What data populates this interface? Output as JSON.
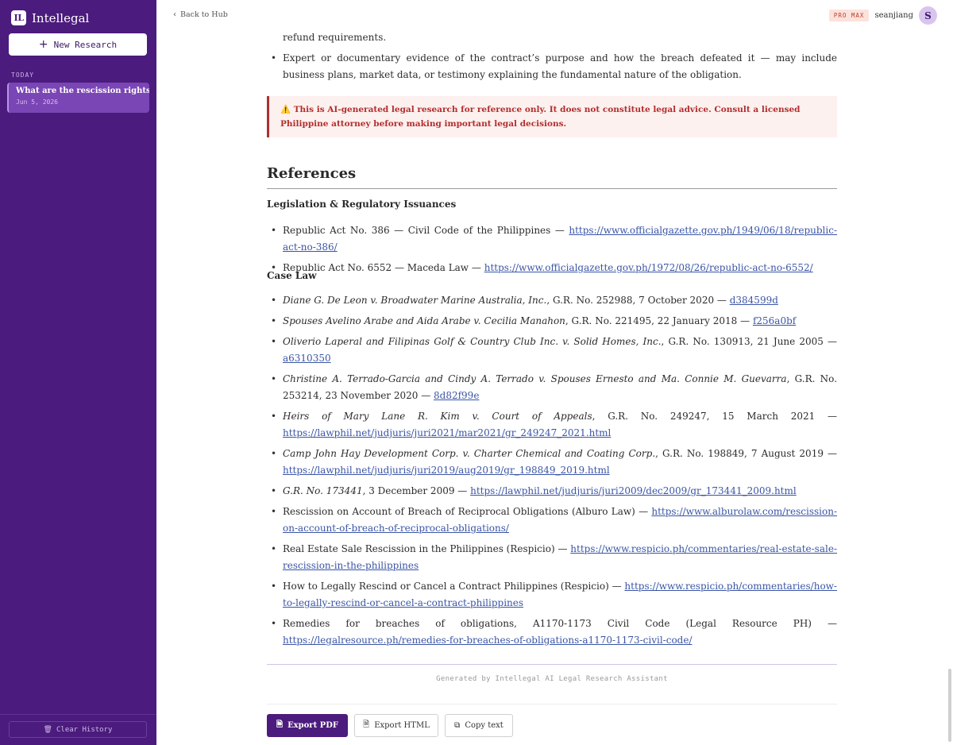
{
  "app": {
    "logo_text": "IL",
    "name": "Intellegal",
    "new_research": "New Research",
    "today_label": "TODAY",
    "history": [
      {
        "title": "What are the rescission rights ...",
        "date": "Jun 5, 2026"
      }
    ],
    "clear_history": "Clear History"
  },
  "topbar": {
    "back": "Back to Hub",
    "plan_badge": "PRO MAX",
    "username": "seanjiang",
    "avatar_initial": "S"
  },
  "content": {
    "intro_tail": "refund requirements.",
    "intro_bullet": "Expert or documentary evidence of the contract’s purpose and how the breach defeated it — may include business plans, market data, or testimony explaining the fundamental nature of the obligation.",
    "warning": "⚠️ This is AI-generated legal research for reference only. It does not constitute legal advice. Consult a licensed Philippine attorney before making important legal decisions.",
    "references_heading": "References",
    "legislation_heading": "Legislation & Regulatory Issuances",
    "legislation": [
      {
        "text": "Republic Act No. 386 — Civil Code of the Philippines — ",
        "link": "https://www.officialgazette.gov.ph/1949/06/18/republic-act-no-386/"
      },
      {
        "text": "Republic Act No. 6552 — Maceda Law — ",
        "link": "https://www.officialgazette.gov.ph/1972/08/26/republic-act-no-6552/"
      }
    ],
    "caselaw_heading": "Case Law",
    "cases": [
      {
        "case": "Diane G. De Leon v. Broadwater Marine Australia, Inc.",
        "citation": ", G.R. No. 252988, 7 October 2020 — ",
        "link": "d384599d"
      },
      {
        "case": "Spouses Avelino Arabe and Aida Arabe v. Cecilia Manahon",
        "citation": ", G.R. No. 221495, 22 January 2018 — ",
        "link": "f256a0bf"
      },
      {
        "case": "Oliverio Laperal and Filipinas Golf & Country Club Inc. v. Solid Homes, Inc.",
        "citation": ", G.R. No. 130913, 21 June 2005 — ",
        "link": "a6310350"
      },
      {
        "case": "Christine A. Terrado-Garcia and Cindy A. Terrado v. Spouses Ernesto and Ma. Connie M. Guevarra",
        "citation": ", G.R. No. 253214, 23 November 2020 — ",
        "link": "8d82f99e"
      },
      {
        "case": "Heirs of Mary Lane R. Kim v. Court of Appeals",
        "citation": ", G.R. No. 249247, 15 March 2021 — ",
        "link": "https://lawphil.net/judjuris/juri2021/mar2021/gr_249247_2021.html"
      },
      {
        "case": "Camp John Hay Development Corp. v. Charter Chemical and Coating Corp.",
        "citation": ", G.R. No. 198849, 7 August 2019 — ",
        "link": "https://lawphil.net/judjuris/juri2019/aug2019/gr_198849_2019.html"
      },
      {
        "case": "G.R. No. 173441",
        "citation": ", 3 December 2009 — ",
        "link": "https://lawphil.net/judjuris/juri2009/dec2009/gr_173441_2009.html"
      }
    ],
    "sources": [
      {
        "text": "Rescission on Account of Breach of Reciprocal Obligations (Alburo Law) — ",
        "link": "https://www.alburolaw.com/rescission-on-account-of-breach-of-reciprocal-obligations/"
      },
      {
        "text": "Real Estate Sale Rescission in the Philippines (Respicio) — ",
        "link": "https://www.respicio.ph/commentaries/real-estate-sale-rescission-in-the-philippines"
      },
      {
        "text": "How to Legally Rescind or Cancel a Contract Philippines (Respicio) — ",
        "link": "https://www.respicio.ph/commentaries/how-to-legally-rescind-or-cancel-a-contract-philippines"
      },
      {
        "text": "Remedies for breaches of obligations, A1170-1173 Civil Code (Legal Resource PH) — ",
        "link": "https://legalresource.ph/remedies-for-breaches-of-obligations-a1170-1173-civil-code/"
      }
    ],
    "generated_by": "Generated by Intellegal AI Legal Research Assistant"
  },
  "actions": {
    "export_pdf": "Export PDF",
    "export_html": "Export HTML",
    "copy_text": "Copy text"
  },
  "colors": {
    "sidebar": "#4b1b7d",
    "accent": "#7a45b5",
    "warning": "#b22e2e",
    "link": "#3a55a6"
  }
}
